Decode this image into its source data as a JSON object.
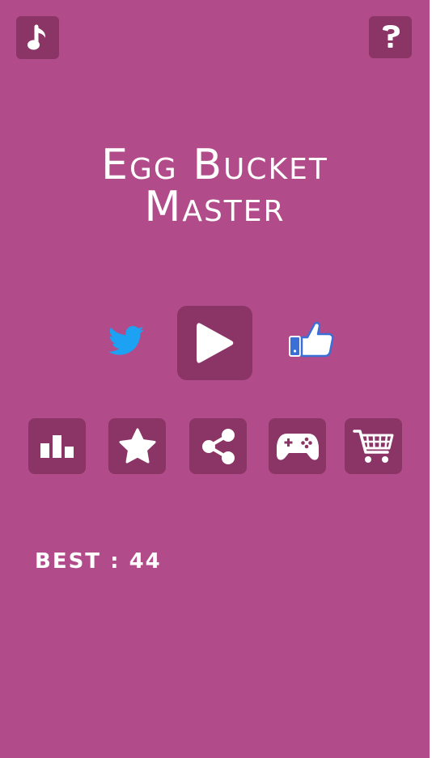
{
  "game": {
    "title_line1": "Egg Bucket",
    "title_line2": "Master"
  },
  "score": {
    "best_label": "BEST",
    "best_separator": " : ",
    "best_value": "44"
  },
  "icons": {
    "music": "music-note-icon",
    "help": "question-mark-icon",
    "play": "play-icon",
    "twitter": "twitter-bird-icon",
    "like": "thumbs-up-icon",
    "leaderboard": "bar-chart-icon",
    "rate": "star-icon",
    "share": "share-icon",
    "games": "gamepad-icon",
    "shop": "shopping-cart-icon"
  },
  "colors": {
    "background": "#b14b8a",
    "button": "#8b3466",
    "icon": "#ffffff",
    "twitter": "#1da1f2",
    "like": "#3b6fd8"
  }
}
